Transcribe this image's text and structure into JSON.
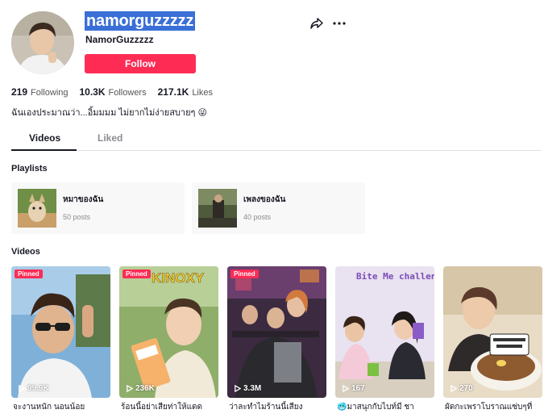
{
  "profile": {
    "username": "namorguzzzzz",
    "nickname": "NamorGuzzzzz",
    "follow_label": "Follow",
    "bio": "ฉันเองประมาณว่า...อิ้มมมม ไม่ยากไม่ง่ายสบายๆ 😜"
  },
  "stats": {
    "following": {
      "value": "219",
      "label": "Following"
    },
    "followers": {
      "value": "10.3K",
      "label": "Followers"
    },
    "likes": {
      "value": "217.1K",
      "label": "Likes"
    }
  },
  "tabs": {
    "videos": "Videos",
    "liked": "Liked"
  },
  "playlists": {
    "title": "Playlists",
    "items": [
      {
        "name": "หมาของฉัน",
        "count": "50 posts"
      },
      {
        "name": "เพลงของฉัน",
        "count": "40 posts"
      }
    ]
  },
  "videos": {
    "title": "Videos",
    "items": [
      {
        "pinned": "Pinned",
        "views": "99.9K",
        "caption": "จะงานหนัก นอนน้อย"
      },
      {
        "pinned": "Pinned",
        "views": "236K",
        "caption": "ร้อนนี้อย่าเสียท่าให้แดด",
        "overlay_text": "KINOXY"
      },
      {
        "pinned": "Pinned",
        "views": "3.3M",
        "caption": "ว่าละทำไมร้านนี้เสียง"
      },
      {
        "views": "167",
        "caption": "🥶มาสนุกกับไบท์มี ชา",
        "overlay_text": "Bite Me challenge"
      },
      {
        "views": "270",
        "caption": "ผัดกะเพราโบราณแซ่บๆที่"
      }
    ]
  },
  "colors": {
    "accent": "#fe2c55",
    "highlight": "#3a6fd8",
    "text": "#161823",
    "muted": "#8a8b91"
  }
}
